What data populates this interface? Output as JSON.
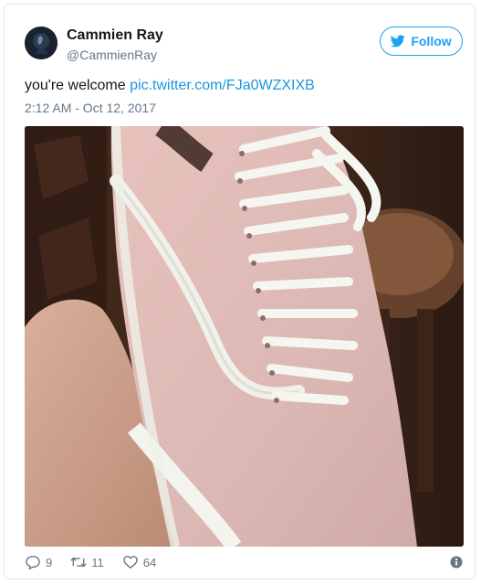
{
  "user": {
    "name": "Cammien Ray",
    "handle": "@CammienRay"
  },
  "follow_label": "Follow",
  "tweet": {
    "text": "you're welcome ",
    "link": "pic.twitter.com/FJa0WZXIXB"
  },
  "timestamp": "2:12 AM - Oct 12, 2017",
  "media": {
    "subject": "pink-and-white-sneaker-photo"
  },
  "actions": {
    "replies": "9",
    "retweets": "11",
    "likes": "64"
  },
  "colors": {
    "accent": "#1da1f2",
    "link": "#1b95e0",
    "secondary_text": "#657786"
  }
}
